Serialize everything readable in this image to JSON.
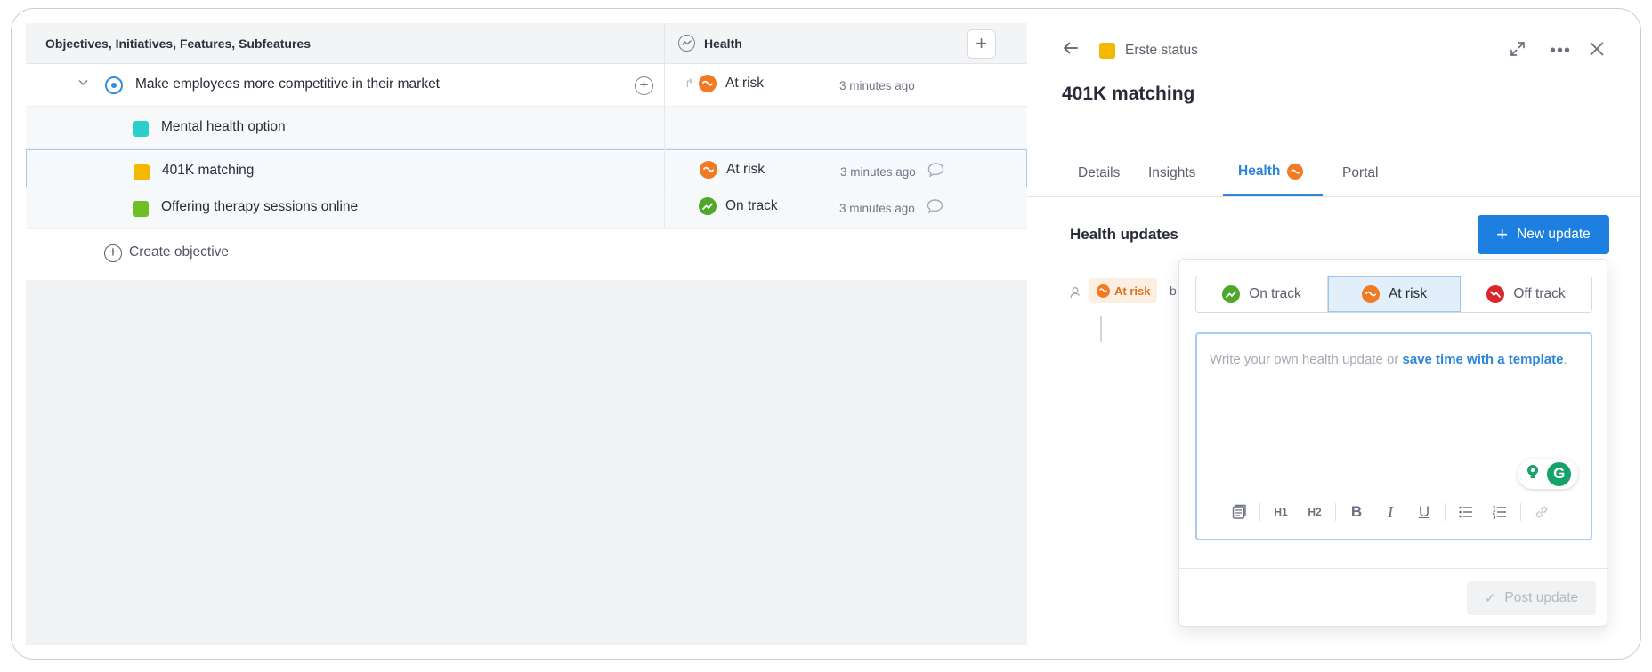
{
  "grid": {
    "column_title": "Objectives, Initiatives, Features, Subfeatures",
    "health_column": "Health",
    "add_column_label": "+",
    "rows": [
      {
        "name": "Make employees more competitive in their market",
        "status": "At risk",
        "updated": "3 minutes ago",
        "type": "objective"
      },
      {
        "name": "Mental health option",
        "status": "",
        "updated": "",
        "type": "feature",
        "color": "#2ad1c9"
      },
      {
        "name": "401K matching",
        "status": "At risk",
        "updated": "3 minutes ago",
        "type": "feature",
        "color": "#f5b800"
      },
      {
        "name": "Offering therapy sessions online",
        "status": "On track",
        "updated": "3 minutes ago",
        "type": "feature",
        "color": "#6cc024"
      }
    ],
    "create_objective": "Create objective"
  },
  "drawer": {
    "status_label": "Erste status",
    "title": "401K matching",
    "tabs": [
      "Details",
      "Insights",
      "Health",
      "Portal"
    ],
    "active_tab": "Health",
    "section_title": "Health updates",
    "new_update_label": "New update",
    "history": {
      "badge": "At risk",
      "by": "b"
    },
    "popover": {
      "options": [
        "On track",
        "At risk",
        "Off track"
      ],
      "selected": "At risk",
      "placeholder_prefix": "Write your own health update or ",
      "placeholder_link": "save time with a template",
      "placeholder_suffix": ".",
      "toolbar": {
        "h1": "H1",
        "h2": "H2",
        "bold": "B",
        "italic": "I",
        "underline": "U"
      },
      "grammarly": "G",
      "post_update_label": "Post update"
    }
  },
  "colors": {
    "accent": "#1d7fe0",
    "at_risk": "#f07b22",
    "on_track": "#4ea82a",
    "off_track": "#d9262c"
  }
}
